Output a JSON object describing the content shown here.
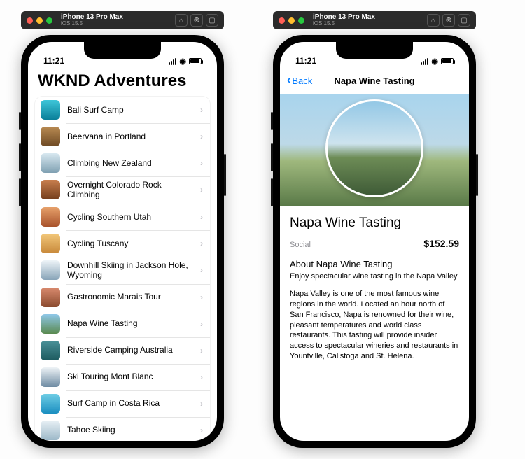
{
  "simulator": {
    "device": "iPhone 13 Pro Max",
    "os": "iOS 15.5"
  },
  "status": {
    "time": "11:21"
  },
  "list_screen": {
    "title": "WKND Adventures",
    "items": [
      {
        "label": "Bali Surf Camp",
        "thumb": "t-surf"
      },
      {
        "label": "Beervana in Portland",
        "thumb": "t-beer"
      },
      {
        "label": "Climbing New Zealand",
        "thumb": "t-climb"
      },
      {
        "label": "Overnight Colorado Rock Climbing",
        "thumb": "t-rock"
      },
      {
        "label": "Cycling Southern Utah",
        "thumb": "t-utah"
      },
      {
        "label": "Cycling Tuscany",
        "thumb": "t-tusc"
      },
      {
        "label": "Downhill Skiing in Jackson Hole, Wyoming",
        "thumb": "t-ski"
      },
      {
        "label": "Gastronomic Marais Tour",
        "thumb": "t-food"
      },
      {
        "label": "Napa Wine Tasting",
        "thumb": "t-napa"
      },
      {
        "label": "Riverside Camping Australia",
        "thumb": "t-river"
      },
      {
        "label": "Ski Touring Mont Blanc",
        "thumb": "t-mont"
      },
      {
        "label": "Surf Camp in Costa Rica",
        "thumb": "t-costa"
      },
      {
        "label": "Tahoe Skiing",
        "thumb": "t-tahoe"
      }
    ]
  },
  "detail_screen": {
    "back_label": "Back",
    "nav_title": "Napa Wine Tasting",
    "title": "Napa Wine Tasting",
    "category": "Social",
    "price": "$152.59",
    "about_heading": "About Napa Wine Tasting",
    "about_sub": "Enjoy spectacular wine tasting in the Napa Valley",
    "about_desc": "Napa Valley is one of the most famous wine regions in the world. Located an hour north of San Francisco, Napa is renowned for their wine, pleasant temperatures and world class restaurants. This tasting will provide insider access to spectacular wineries and restaurants in Yountville, Calistoga and St. Helena."
  }
}
